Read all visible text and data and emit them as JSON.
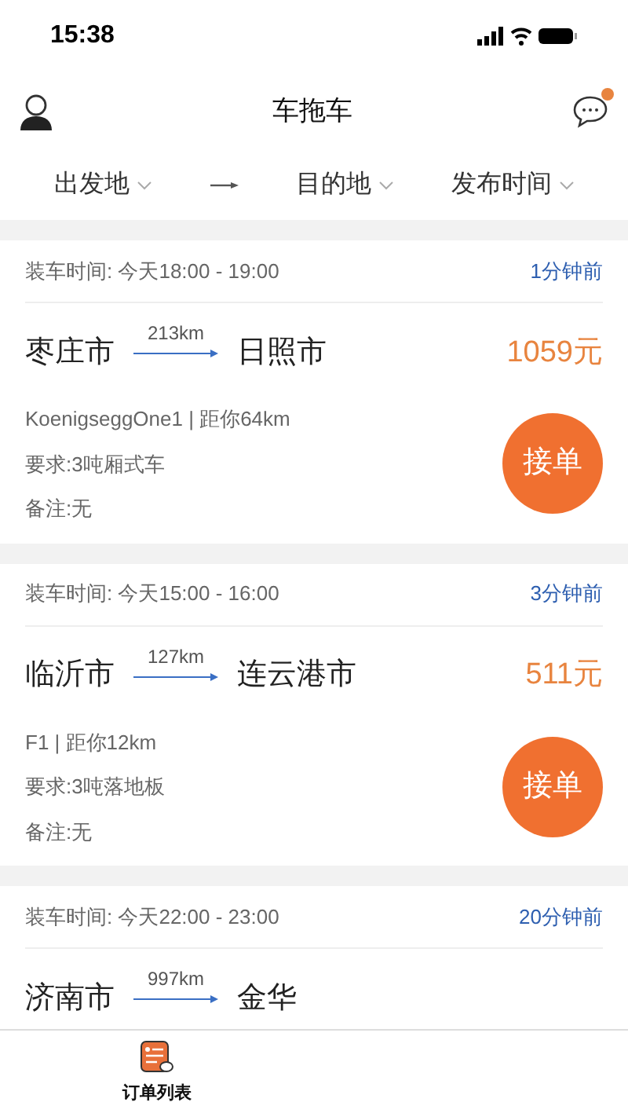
{
  "status_bar": {
    "time": "15:38"
  },
  "nav": {
    "title": "车拖车",
    "has_unread": true
  },
  "filters": [
    {
      "label": "出发地",
      "kind": "dropdown"
    },
    {
      "kind": "arrow"
    },
    {
      "label": "目的地",
      "kind": "dropdown"
    },
    {
      "label": "发布时间",
      "kind": "dropdown"
    }
  ],
  "orders": [
    {
      "load_time": "装车时间: 今天18:00 - 19:00",
      "posted": "1分钟前",
      "from": "枣庄市",
      "distance": "213km",
      "to": "日照市",
      "price": "1059元",
      "shipper": "KoenigseggOne1 | 距你64km",
      "requirement": "要求:3吨厢式车",
      "note": "备注:无",
      "action": "接单"
    },
    {
      "load_time": "装车时间: 今天15:00 - 16:00",
      "posted": "3分钟前",
      "from": "临沂市",
      "distance": "127km",
      "to": "连云港市",
      "price": "511元",
      "shipper": "F1 | 距你12km",
      "requirement": "要求:3吨落地板",
      "note": "备注:无",
      "action": "接单"
    },
    {
      "load_time": "装车时间: 今天22:00 - 23:00",
      "posted": "20分钟前",
      "from": "济南市",
      "distance": "997km",
      "to": "金华"
    }
  ],
  "tab_bar": [
    {
      "label": "订单列表",
      "selected": true
    }
  ]
}
